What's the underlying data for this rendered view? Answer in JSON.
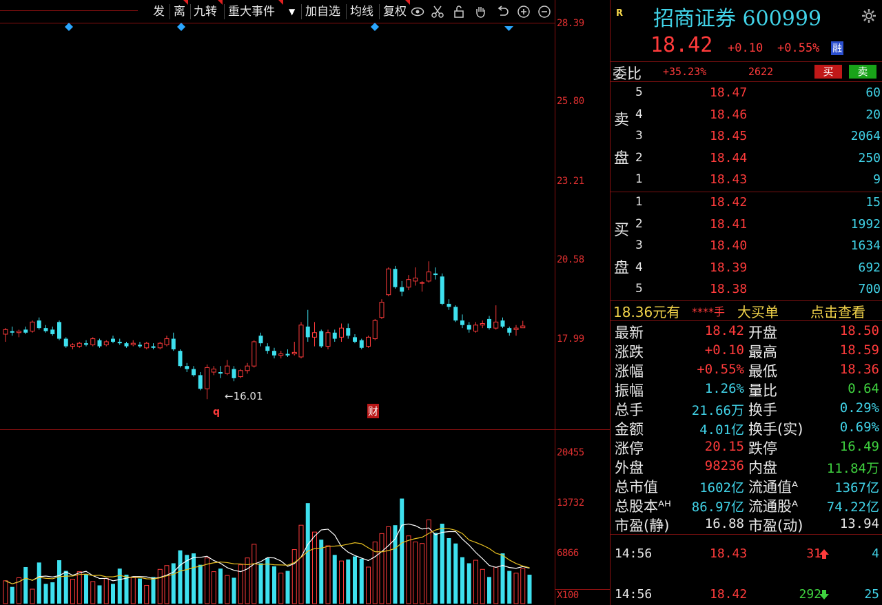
{
  "toolbar": {
    "items": [
      "发",
      "离",
      "九转",
      "重大事件",
      "加自选",
      "均线",
      "复权"
    ],
    "dropdown_arrow": "▼"
  },
  "price_axis": [
    "28.39",
    "25.80",
    "23.21",
    "20.58",
    "17.99"
  ],
  "volume_axis": [
    "20455",
    "13732",
    "6866",
    "X100"
  ],
  "chart_annotations": {
    "low_marker": "←16.01",
    "event_q": "q",
    "event_cai": "财"
  },
  "chart_data": {
    "type": "candlestick",
    "ylim": [
      15.5,
      28.39
    ],
    "candles": [
      {
        "o": 18.15,
        "h": 18.35,
        "l": 17.9,
        "c": 18.3
      },
      {
        "o": 18.25,
        "h": 18.4,
        "l": 18.1,
        "c": 18.2
      },
      {
        "o": 18.2,
        "h": 18.3,
        "l": 18.05,
        "c": 18.25
      },
      {
        "o": 18.3,
        "h": 18.4,
        "l": 18.15,
        "c": 18.2
      },
      {
        "o": 18.25,
        "h": 18.6,
        "l": 18.2,
        "c": 18.55
      },
      {
        "o": 18.6,
        "h": 18.7,
        "l": 18.3,
        "c": 18.35
      },
      {
        "o": 18.35,
        "h": 18.45,
        "l": 18.2,
        "c": 18.25
      },
      {
        "o": 18.3,
        "h": 18.4,
        "l": 18.1,
        "c": 18.15
      },
      {
        "o": 18.55,
        "h": 18.6,
        "l": 17.95,
        "c": 18.0
      },
      {
        "o": 18.0,
        "h": 18.05,
        "l": 17.7,
        "c": 17.75
      },
      {
        "o": 17.75,
        "h": 17.85,
        "l": 17.65,
        "c": 17.8
      },
      {
        "o": 17.75,
        "h": 17.9,
        "l": 17.7,
        "c": 17.85
      },
      {
        "o": 17.85,
        "h": 17.95,
        "l": 17.75,
        "c": 17.8
      },
      {
        "o": 17.8,
        "h": 18.05,
        "l": 17.75,
        "c": 18.0
      },
      {
        "o": 17.95,
        "h": 18.0,
        "l": 17.7,
        "c": 17.75
      },
      {
        "o": 17.8,
        "h": 17.95,
        "l": 17.75,
        "c": 17.9
      },
      {
        "o": 18.0,
        "h": 18.1,
        "l": 17.85,
        "c": 17.9
      },
      {
        "o": 17.9,
        "h": 18.0,
        "l": 17.8,
        "c": 17.85
      },
      {
        "o": 17.85,
        "h": 17.9,
        "l": 17.7,
        "c": 17.75
      },
      {
        "o": 17.8,
        "h": 17.95,
        "l": 17.75,
        "c": 17.85
      },
      {
        "o": 17.8,
        "h": 17.9,
        "l": 17.7,
        "c": 17.75
      },
      {
        "o": 17.7,
        "h": 17.9,
        "l": 17.65,
        "c": 17.85
      },
      {
        "o": 17.75,
        "h": 17.85,
        "l": 17.65,
        "c": 17.7
      },
      {
        "o": 17.7,
        "h": 17.9,
        "l": 17.65,
        "c": 17.85
      },
      {
        "o": 17.8,
        "h": 18.1,
        "l": 17.75,
        "c": 18.0
      },
      {
        "o": 18.0,
        "h": 18.2,
        "l": 17.6,
        "c": 17.65
      },
      {
        "o": 17.6,
        "h": 17.65,
        "l": 17.05,
        "c": 17.1
      },
      {
        "o": 17.1,
        "h": 17.2,
        "l": 16.9,
        "c": 17.0
      },
      {
        "o": 17.0,
        "h": 17.1,
        "l": 16.75,
        "c": 16.8
      },
      {
        "o": 16.8,
        "h": 16.9,
        "l": 16.3,
        "c": 16.35
      },
      {
        "o": 16.35,
        "h": 17.15,
        "l": 16.01,
        "c": 17.05
      },
      {
        "o": 16.9,
        "h": 17.1,
        "l": 16.8,
        "c": 17.0
      },
      {
        "o": 16.9,
        "h": 17.1,
        "l": 16.7,
        "c": 16.85
      },
      {
        "o": 16.85,
        "h": 17.3,
        "l": 16.8,
        "c": 17.1
      },
      {
        "o": 17.0,
        "h": 17.1,
        "l": 16.6,
        "c": 16.7
      },
      {
        "o": 16.75,
        "h": 17.0,
        "l": 16.7,
        "c": 16.95
      },
      {
        "o": 16.95,
        "h": 17.2,
        "l": 16.85,
        "c": 17.1
      },
      {
        "o": 17.1,
        "h": 17.95,
        "l": 17.05,
        "c": 17.9
      },
      {
        "o": 18.1,
        "h": 18.2,
        "l": 17.75,
        "c": 17.85
      },
      {
        "o": 17.75,
        "h": 17.85,
        "l": 17.5,
        "c": 17.6
      },
      {
        "o": 17.6,
        "h": 17.7,
        "l": 17.35,
        "c": 17.45
      },
      {
        "o": 17.45,
        "h": 17.6,
        "l": 17.35,
        "c": 17.5
      },
      {
        "o": 17.5,
        "h": 17.65,
        "l": 17.4,
        "c": 17.45
      },
      {
        "o": 17.5,
        "h": 17.9,
        "l": 17.45,
        "c": 17.55
      },
      {
        "o": 17.4,
        "h": 18.55,
        "l": 17.35,
        "c": 18.45
      },
      {
        "o": 18.4,
        "h": 18.95,
        "l": 17.9,
        "c": 18.05
      },
      {
        "o": 18.05,
        "h": 18.55,
        "l": 17.75,
        "c": 18.2
      },
      {
        "o": 18.25,
        "h": 18.3,
        "l": 17.7,
        "c": 17.75
      },
      {
        "o": 17.75,
        "h": 18.3,
        "l": 17.65,
        "c": 18.2
      },
      {
        "o": 18.2,
        "h": 18.3,
        "l": 17.9,
        "c": 18.0
      },
      {
        "o": 18.05,
        "h": 18.5,
        "l": 17.9,
        "c": 18.35
      },
      {
        "o": 18.35,
        "h": 18.5,
        "l": 18.0,
        "c": 18.1
      },
      {
        "o": 18.05,
        "h": 18.15,
        "l": 17.85,
        "c": 17.9
      },
      {
        "o": 17.95,
        "h": 18.0,
        "l": 17.65,
        "c": 17.7
      },
      {
        "o": 17.75,
        "h": 18.1,
        "l": 17.7,
        "c": 18.05
      },
      {
        "o": 18.0,
        "h": 18.65,
        "l": 17.95,
        "c": 18.6
      },
      {
        "o": 18.7,
        "h": 19.3,
        "l": 18.65,
        "c": 19.2
      },
      {
        "o": 19.45,
        "h": 20.35,
        "l": 19.4,
        "c": 20.3
      },
      {
        "o": 20.3,
        "h": 20.4,
        "l": 19.65,
        "c": 19.7
      },
      {
        "o": 19.7,
        "h": 19.9,
        "l": 19.4,
        "c": 19.55
      },
      {
        "o": 19.7,
        "h": 20.1,
        "l": 19.6,
        "c": 19.95
      },
      {
        "o": 19.9,
        "h": 20.35,
        "l": 19.75,
        "c": 20.0
      },
      {
        "o": 19.85,
        "h": 19.9,
        "l": 19.55,
        "c": 19.85
      },
      {
        "o": 19.9,
        "h": 20.55,
        "l": 19.85,
        "c": 20.2
      },
      {
        "o": 20.15,
        "h": 20.35,
        "l": 19.95,
        "c": 20.1
      },
      {
        "o": 20.05,
        "h": 20.15,
        "l": 19.1,
        "c": 19.15
      },
      {
        "o": 19.15,
        "h": 19.3,
        "l": 18.95,
        "c": 19.05
      },
      {
        "o": 19.05,
        "h": 19.1,
        "l": 18.55,
        "c": 18.6
      },
      {
        "o": 18.6,
        "h": 18.8,
        "l": 18.35,
        "c": 18.45
      },
      {
        "o": 18.45,
        "h": 18.55,
        "l": 18.2,
        "c": 18.3
      },
      {
        "o": 18.25,
        "h": 18.55,
        "l": 18.2,
        "c": 18.45
      },
      {
        "o": 18.45,
        "h": 18.6,
        "l": 18.35,
        "c": 18.5
      },
      {
        "o": 18.65,
        "h": 18.75,
        "l": 18.3,
        "c": 18.35
      },
      {
        "o": 18.35,
        "h": 19.1,
        "l": 18.3,
        "c": 18.55
      },
      {
        "o": 18.6,
        "h": 18.7,
        "l": 18.35,
        "c": 18.4
      },
      {
        "o": 18.35,
        "h": 18.4,
        "l": 18.1,
        "c": 18.2
      },
      {
        "o": 18.3,
        "h": 18.45,
        "l": 18.1,
        "c": 18.35
      },
      {
        "o": 18.36,
        "h": 18.59,
        "l": 18.36,
        "c": 18.42
      }
    ],
    "volume_ylim": [
      0,
      22000
    ],
    "volumes": [
      3000,
      2200,
      3400,
      4800,
      1900,
      5400,
      2600,
      2800,
      5700,
      4300,
      3200,
      4200,
      3800,
      2900,
      2400,
      3300,
      2600,
      4600,
      3800,
      3500,
      3300,
      2400,
      3500,
      4500,
      5000,
      5300,
      7000,
      6400,
      6600,
      5100,
      6000,
      4200,
      4600,
      3700,
      3400,
      5100,
      6000,
      7800,
      5300,
      6000,
      4900,
      4000,
      4300,
      7100,
      10300,
      13200,
      9400,
      8400,
      7600,
      6400,
      5600,
      5800,
      6200,
      5900,
      4800,
      8100,
      9200,
      10100,
      10300,
      13800,
      8900,
      8100,
      7900,
      11000,
      9300,
      10500,
      8600,
      7900,
      6100,
      5300,
      5700,
      4500,
      3500,
      4800,
      6600,
      4300,
      4000,
      4600,
      3800
    ]
  },
  "quote": {
    "badge": "R",
    "title": "招商证券 600999",
    "price": "18.42",
    "change": "+0.10",
    "change_pct": "+0.55%",
    "finance_badge": "融",
    "wei_bi_label": "委比",
    "wei_bi_pct": "+35.23%",
    "wei_bi_diff": "2622",
    "buy_btn": "买",
    "sell_btn": "卖",
    "sell_side_label": [
      "卖",
      "盘"
    ],
    "buy_side_label": [
      "买",
      "盘"
    ],
    "asks": [
      {
        "level": "5",
        "price": "18.47",
        "vol": "60"
      },
      {
        "level": "4",
        "price": "18.46",
        "vol": "20"
      },
      {
        "level": "3",
        "price": "18.45",
        "vol": "2064"
      },
      {
        "level": "2",
        "price": "18.44",
        "vol": "250"
      },
      {
        "level": "1",
        "price": "18.43",
        "vol": "9"
      }
    ],
    "bids": [
      {
        "level": "1",
        "price": "18.42",
        "vol": "15"
      },
      {
        "level": "2",
        "price": "18.41",
        "vol": "1992"
      },
      {
        "level": "3",
        "price": "18.40",
        "vol": "1634"
      },
      {
        "level": "4",
        "price": "18.39",
        "vol": "692"
      },
      {
        "level": "5",
        "price": "18.38",
        "vol": "700"
      }
    ],
    "big_order": {
      "price_text": "18.36元有",
      "stars": "****手",
      "label": "大买单",
      "link": "点击查看"
    },
    "stats": [
      {
        "l1": "最新",
        "v1": "18.42",
        "c1": "red",
        "l2": "开盘",
        "v2": "18.50",
        "c2": "red"
      },
      {
        "l1": "涨跌",
        "v1": "+0.10",
        "c1": "red",
        "l2": "最高",
        "v2": "18.59",
        "c2": "red"
      },
      {
        "l1": "涨幅",
        "v1": "+0.55%",
        "c1": "red",
        "l2": "最低",
        "v2": "18.36",
        "c2": "red"
      },
      {
        "l1": "振幅",
        "v1": "1.26%",
        "c1": "cyan",
        "l2": "量比",
        "v2": "0.64",
        "c2": "green"
      },
      {
        "l1": "总手",
        "v1": "21.66万",
        "c1": "cyan",
        "l2": "换手",
        "v2": "0.29%",
        "c2": "cyan"
      },
      {
        "l1": "金额",
        "v1": "4.01亿",
        "c1": "cyan",
        "l2": "换手(实)",
        "v2": "0.69%",
        "c2": "cyan"
      },
      {
        "l1": "涨停",
        "v1": "20.15",
        "c1": "red",
        "l2": "跌停",
        "v2": "16.49",
        "c2": "green"
      },
      {
        "l1": "外盘",
        "v1": "98236",
        "c1": "red",
        "l2": "内盘",
        "v2": "11.84万",
        "c2": "green"
      },
      {
        "l1": "总市值",
        "v1": "1602亿",
        "c1": "cyan",
        "l2": "流通值ᴬ",
        "v2": "1367亿",
        "c2": "cyan"
      },
      {
        "l1": "总股本ᴬᴴ",
        "v1": "86.97亿",
        "c1": "cyan",
        "l2": "流通股ᴬ",
        "v2": "74.22亿",
        "c2": "cyan"
      },
      {
        "l1": "市盈(静)",
        "v1": "16.88",
        "c1": "white",
        "l2": "市盈(动)",
        "v2": "13.94",
        "c2": "white"
      }
    ],
    "ticks": [
      {
        "time": "14:56",
        "price": "18.43",
        "vol": "31",
        "dir": "up",
        "count": "4"
      },
      {
        "time": "14:56",
        "price": "18.42",
        "vol": "292",
        "dir": "down",
        "count": "25"
      }
    ],
    "colors": {
      "up": "#ff3b3b",
      "down": "#3fd23f",
      "cyan": "#41d3e8",
      "title": "#41d3e8",
      "grid": "#7a1010"
    }
  }
}
